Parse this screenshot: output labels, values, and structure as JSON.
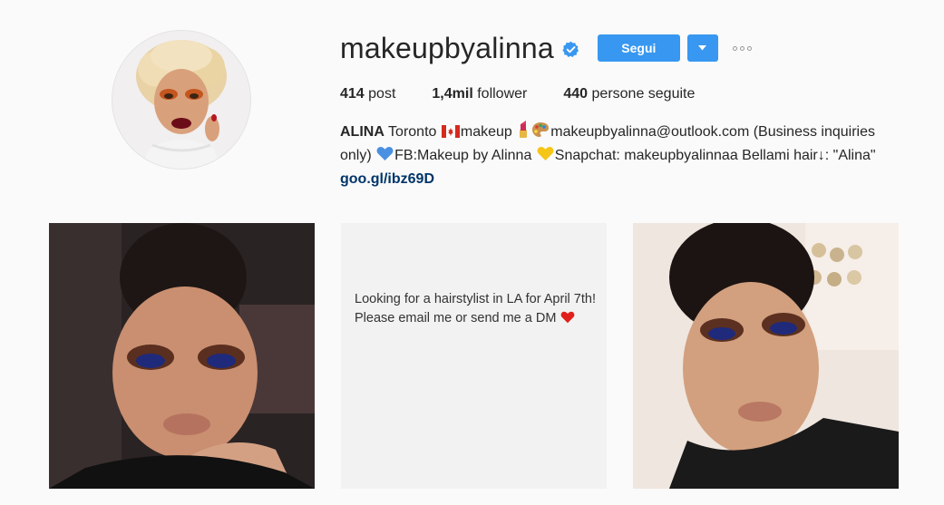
{
  "profile": {
    "username": "makeupbyalinna",
    "verified_icon": "verified-badge-icon",
    "follow_label": "Segui",
    "dropdown_icon": "caret-down-icon",
    "more_icon": "more-options-icon"
  },
  "stats": {
    "posts_count": "414",
    "posts_label": "post",
    "followers_count": "1,4mil",
    "followers_label": "follower",
    "following_count": "440",
    "following_label": "persone seguite"
  },
  "bio": {
    "name": "ALINA",
    "city": "Toronto",
    "flag_icon": "canada-flag-icon",
    "part1": "makeup",
    "lipstick_icon": "lipstick-icon",
    "palette_icon": "palette-icon",
    "email_text": "makeupbyalinna@outlook.com (Business inquiries only)",
    "blue_heart_icon": "blue-heart-icon",
    "fb_text": "FB:Makeup by Alinna",
    "yellow_heart_icon": "yellow-heart-icon",
    "snap_text": "Snapchat: makeupbyalinnaa Bellami hair↓: \"Alina\"",
    "link": "goo.gl/ibz69D"
  },
  "posts": {
    "text_post_line1": "Looking for a hairstylist in LA for April 7th!",
    "text_post_line2": "Please email me or send me a DM",
    "heart_icon": "red-heart-icon"
  },
  "colors": {
    "accent": "#3897f0",
    "link": "#003569",
    "background": "#fafafa"
  }
}
